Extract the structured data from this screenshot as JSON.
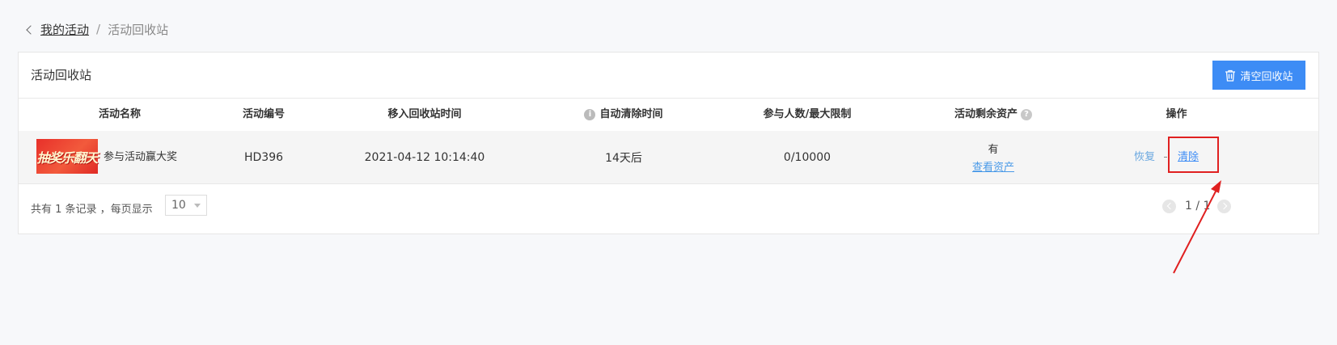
{
  "breadcrumb": {
    "parent": "我的活动",
    "separator": "/",
    "current": "活动回收站"
  },
  "panel": {
    "title": "活动回收站",
    "clear_button": "清空回收站"
  },
  "table": {
    "columns": [
      "活动名称",
      "活动编号",
      "移入回收站时间",
      "自动清除时间",
      "参与人数/最大限制",
      "活动剩余资产",
      "操作"
    ],
    "rows": [
      {
        "thumb_text": "抽奖乐翻天",
        "name": "参与活动赢大奖",
        "code": "HD396",
        "moved_time": "2021-04-12 10:14:40",
        "auto_clear": "14天后",
        "participants": "0/10000",
        "asset": "有",
        "asset_link": "查看资产",
        "restore": "恢复",
        "clear": "清除"
      }
    ]
  },
  "footer": {
    "total_text": "共有 1 条记录 ，每页显示",
    "page_size": "10",
    "pager": "1 / 1"
  },
  "colors": {
    "primary": "#3d8cf5",
    "highlight": "#e02020",
    "arrow": "#e02020"
  }
}
